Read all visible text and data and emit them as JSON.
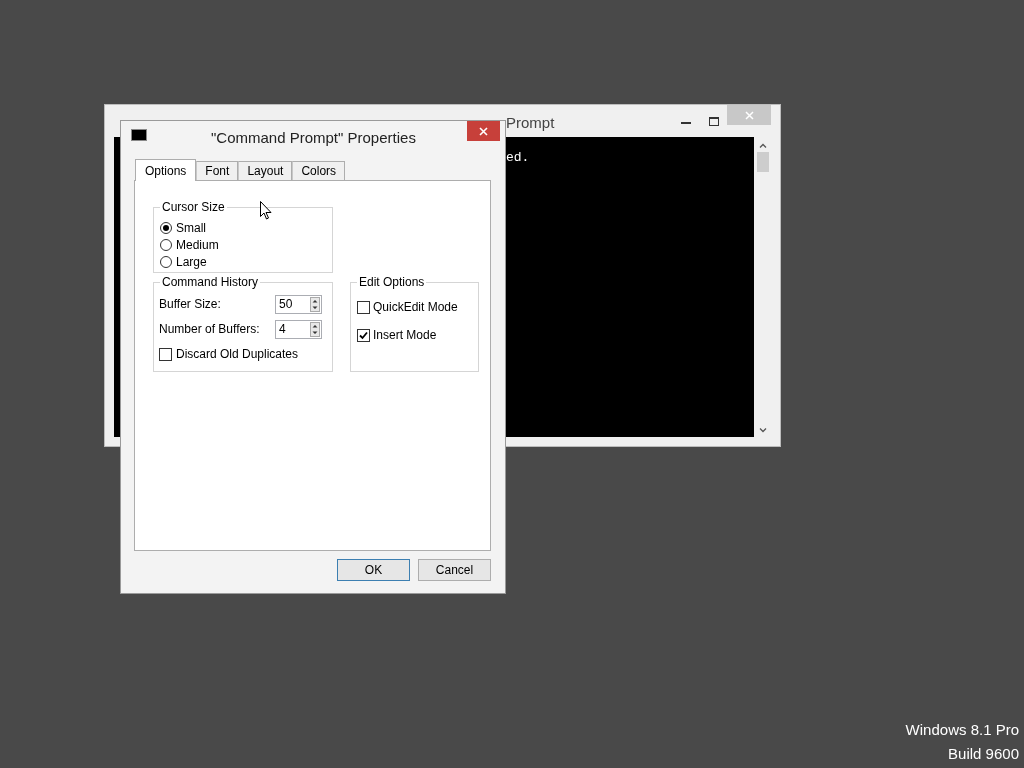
{
  "background_window": {
    "title": "Prompt",
    "console_text": "ed."
  },
  "dialog": {
    "title": "\"Command Prompt\" Properties",
    "tabs": [
      {
        "label": "Options",
        "selected": true
      },
      {
        "label": "Font",
        "selected": false
      },
      {
        "label": "Layout",
        "selected": false
      },
      {
        "label": "Colors",
        "selected": false
      }
    ],
    "cursor_size": {
      "label": "Cursor Size",
      "options": [
        {
          "label": "Small",
          "selected": true
        },
        {
          "label": "Medium",
          "selected": false
        },
        {
          "label": "Large",
          "selected": false
        }
      ]
    },
    "command_history": {
      "label": "Command History",
      "fields": [
        {
          "label": "Buffer Size:",
          "value": "50"
        },
        {
          "label": "Number of Buffers:",
          "value": "4"
        }
      ],
      "discard": {
        "label": "Discard Old Duplicates",
        "checked": false
      }
    },
    "edit_options": {
      "label": "Edit Options",
      "options": [
        {
          "label": "QuickEdit Mode",
          "checked": false
        },
        {
          "label": "Insert Mode",
          "checked": true
        }
      ]
    },
    "buttons": [
      {
        "label": "OK",
        "default": true
      },
      {
        "label": "Cancel",
        "default": false
      }
    ]
  },
  "os_label": [
    "Windows 8.1 Pro",
    "Build 9600"
  ]
}
